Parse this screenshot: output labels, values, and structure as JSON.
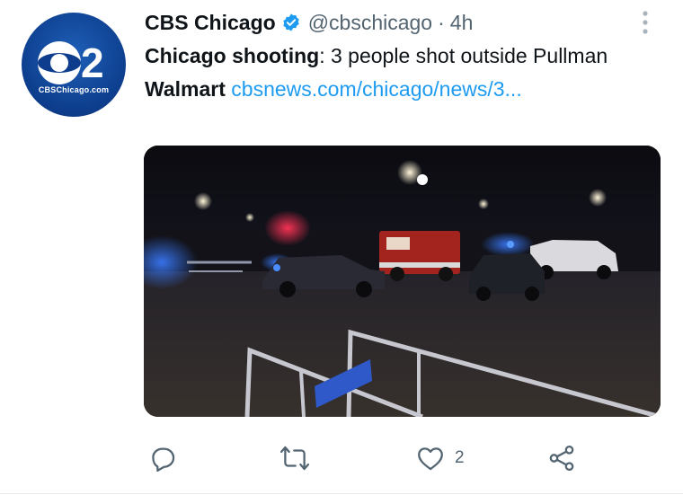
{
  "author": {
    "display_name": "CBS Chicago",
    "handle": "@cbschicago",
    "separator": "·",
    "timestamp": "4h",
    "avatar_text": "CBSChicago.com",
    "verified": true
  },
  "tweet": {
    "bold_1": "Chicago shooting",
    "text_1": ": 3 people shot outside Pullman ",
    "bold_2": "Walmart",
    "text_2": " ",
    "link": "cbsnews.com/chicago/news/3..."
  },
  "media": {
    "description_icon": "photo"
  },
  "actions": {
    "reply_icon": "reply-icon",
    "retweet_icon": "retweet-icon",
    "like_icon": "heart-icon",
    "like_count": "2",
    "share_icon": "share-icon"
  },
  "colors": {
    "link": "#1d9bf0",
    "secondary_text": "#536471",
    "verified_badge": "#1d9bf0",
    "avatar_blue": "#0d3d8c"
  }
}
